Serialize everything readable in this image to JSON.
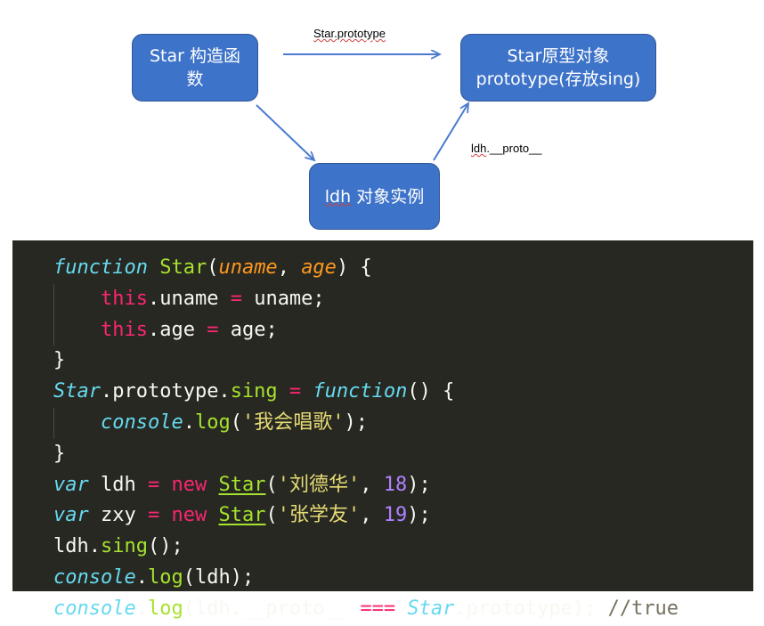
{
  "diagram": {
    "star_constructor": [
      "Star 构造函",
      "数"
    ],
    "star_prototype_object": [
      "Star原型对象",
      "prototype(存放sing)"
    ],
    "instance": {
      "prefix": "ldh",
      "suffix": " 对象实例"
    },
    "edge_star_to_proto": "Star.prototype",
    "edge_ldh_to_proto": {
      "prefix": "ldh",
      "suffix": ".__proto__"
    }
  },
  "code": {
    "line1": {
      "kw": "function",
      "name": "Star",
      "open": "(",
      "p1": "uname",
      "comma": ", ",
      "p2": "age",
      "close": ") {"
    },
    "line2": {
      "this": "this",
      "rest": ".uname ",
      "op": "=",
      "rhs": " uname;"
    },
    "line3": {
      "this": "this",
      "rest": ".age ",
      "op": "=",
      "rhs": " age;"
    },
    "line4": "}",
    "line5": {
      "obj": "Star",
      "dot": ".prototype.",
      "method": "sing",
      "sp": " ",
      "op": "=",
      "sp2": " ",
      "fn": "function",
      "tail": "() {"
    },
    "line6": {
      "obj": "console",
      "dot": ".",
      "method": "log",
      "open": "(",
      "str": "'我会唱歌'",
      "close": ");"
    },
    "line7": "}",
    "line8": {
      "var": "var",
      "name": " ldh ",
      "op": "=",
      "sp": " ",
      "new": "new",
      "sp2": " ",
      "cls": "Star",
      "open": "(",
      "str": "'刘德华'",
      "comma": ", ",
      "num": "18",
      "close": ");"
    },
    "line9": {
      "var": "var",
      "name": " zxy ",
      "op": "=",
      "sp": " ",
      "new": "new",
      "sp2": " ",
      "cls": "Star",
      "open": "(",
      "str": "'张学友'",
      "comma": ", ",
      "num": "19",
      "close": ");"
    },
    "line10": {
      "obj": "ldh.",
      "method": "sing",
      "tail": "();"
    },
    "line11": {
      "obj": "console",
      "dot": ".",
      "method": "log",
      "tail": "(ldh);"
    },
    "line12": {
      "obj": "console",
      "dot": ".",
      "method": "log",
      "mid": "(ldh.__proto__ ",
      "op": "===",
      "sp": " ",
      "cls": "Star",
      "tail": ".prototype); ",
      "comment": "//true"
    }
  },
  "colors": {
    "node_fill": "#3d73c8",
    "arrow": "#4a7bd0",
    "code_bg": "#272822"
  }
}
